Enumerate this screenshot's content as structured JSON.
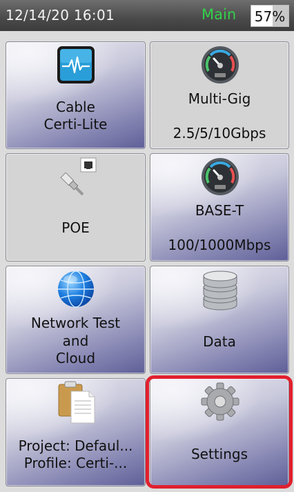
{
  "status": {
    "datetime": "12/14/20 16:01",
    "mode": "Main",
    "battery_percent": 57,
    "battery_text": "57%"
  },
  "tiles": [
    {
      "id": "cable-certi-lite",
      "line1": "Cable",
      "line2": "Certi-Lite",
      "icon": "oscilloscope-icon"
    },
    {
      "id": "multi-gig",
      "line1": "Multi-Gig",
      "line2": "2.5/5/10Gbps",
      "icon": "gauge-icon"
    },
    {
      "id": "poe",
      "line1": "POE",
      "icon": "ethernet-plug-icon"
    },
    {
      "id": "base-t",
      "line1": "BASE-T",
      "line2": "100/1000Mbps",
      "icon": "gauge-icon"
    },
    {
      "id": "network-test-cloud",
      "line1": "Network Test",
      "line2": "and",
      "line3": "Cloud",
      "icon": "globe-icon"
    },
    {
      "id": "data",
      "line1": "Data",
      "icon": "database-icon"
    },
    {
      "id": "project-profile",
      "line1": "Project: Defaul...",
      "line2": "Profile: Certi-...",
      "icon": "clipboard-icon"
    },
    {
      "id": "settings",
      "line1": "Settings",
      "icon": "gear-icon"
    }
  ],
  "colors": {
    "mode_text": "#33d14a",
    "highlight_border": "#e0202e"
  }
}
